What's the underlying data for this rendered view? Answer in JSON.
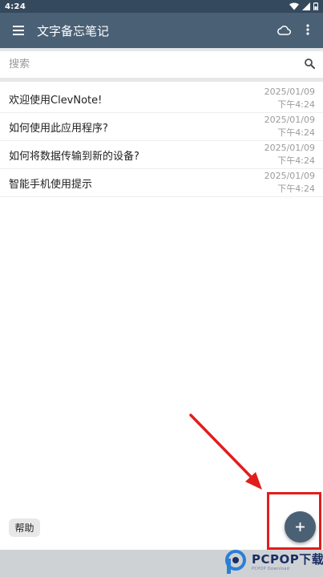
{
  "status_bar": {
    "time": "4:24",
    "icons": [
      "wifi-icon",
      "signal-icon",
      "battery-icon"
    ]
  },
  "app_bar": {
    "title": "文字备忘笔记",
    "icons": [
      "menu-icon",
      "cloud-icon",
      "more-vert-icon"
    ],
    "color": "#4a6075"
  },
  "search": {
    "placeholder": "搜索",
    "value": ""
  },
  "notes": [
    {
      "title": "欢迎使用ClevNote!",
      "date": "2025/01/09",
      "time": "下午4:24"
    },
    {
      "title": "如何使用此应用程序?",
      "date": "2025/01/09",
      "time": "下午4:24"
    },
    {
      "title": "如何将数据传输到新的设备?",
      "date": "2025/01/09",
      "time": "下午4:24"
    },
    {
      "title": "智能手机使用提示",
      "date": "2025/01/09",
      "time": "下午4:24"
    }
  ],
  "help_button": {
    "label": "帮助"
  },
  "fab": {
    "icon": "plus-icon",
    "label": "+"
  },
  "annotation": {
    "color": "#e21d1d"
  },
  "watermark": {
    "brand": "PCPOP下载",
    "sub": "PCPOP Download"
  }
}
